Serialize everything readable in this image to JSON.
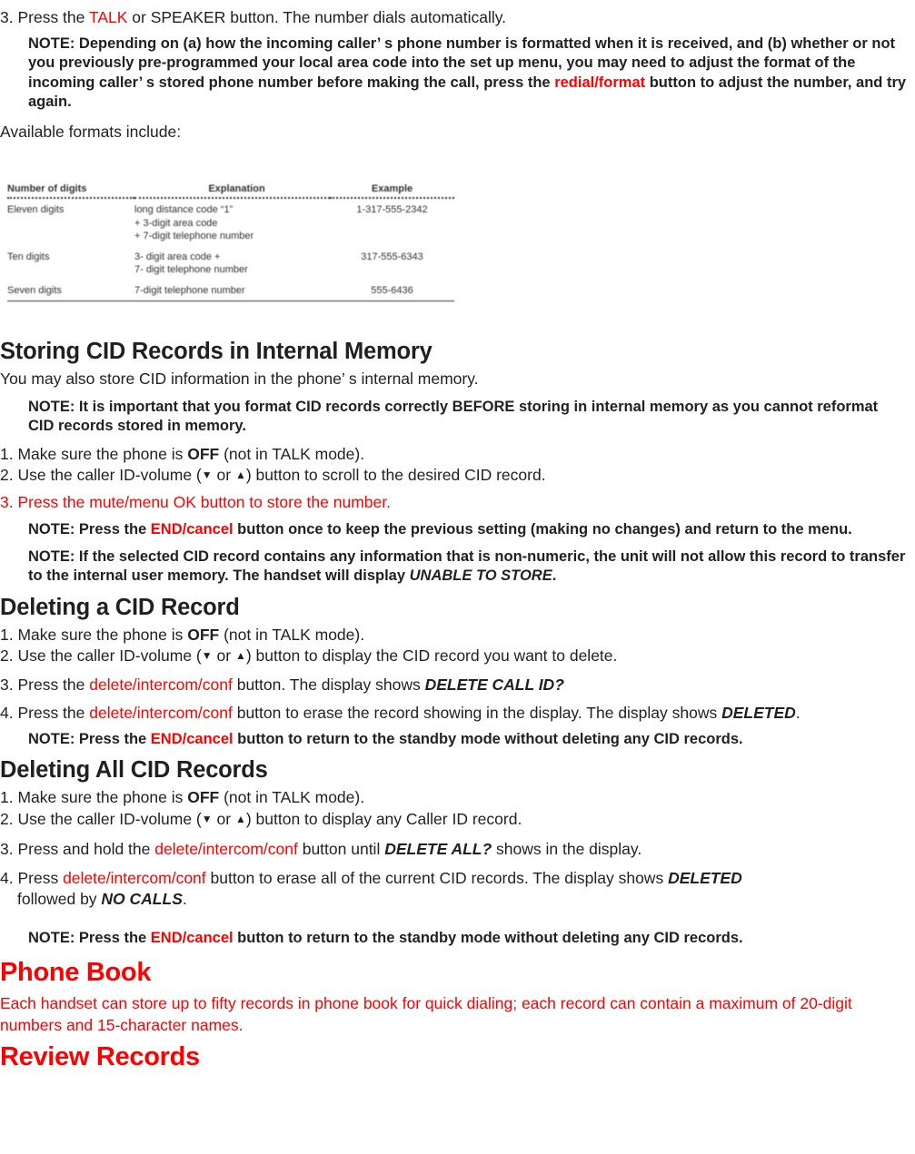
{
  "document": {
    "title": "Phone Book / CID Records Manual Page"
  },
  "colors": {
    "red": "#ff0000",
    "text": "#231f20"
  },
  "top_section": {
    "step3": {
      "num": "3. Press the ",
      "talk": "TALK",
      "rest": " or SPEAKER button. The number dials automatically."
    },
    "note1": {
      "lead": "NOTE: Depending on (a) how the incoming caller’ s phone number is formatted when it is received, and (b) whether or not you previously pre-programmed your local area code int",
      "lead2": "o the set up menu, you may need to adjust the format of the incoming caller’ s stored phone number before making the call, press the ",
      "redial": "redial/format",
      "tail": " button to adjust the number, and try again."
    },
    "available": "Available formats include:"
  },
  "formats_table": {
    "headers": [
      "Number of digits",
      "Explanation",
      "Example"
    ],
    "rows": [
      {
        "digits": "Eleven digits",
        "explanation": [
          "long distance code “1”",
          "+ 3-digit area code",
          "+ 7-digit telephone number"
        ],
        "example": "1-317-555-2342"
      },
      {
        "digits": "Ten digits",
        "explanation": [
          "3- digit area code +",
          "7- digit telephone number"
        ],
        "example": "317-555-6343"
      },
      {
        "digits": "Seven digits",
        "explanation": [
          "7-digit telephone number"
        ],
        "example": "555-6436"
      }
    ]
  },
  "storing": {
    "heading": "Storing CID Records in Internal Memory",
    "intro": "You may also store CID information in the phone’ s internal memory.",
    "note": "NOTE: It is important that you format CID records correctly BEFORE storing in internal memory as you cannot reformat CID records stored in memory.",
    "step1": {
      "pre": "1. Make sure the phone is ",
      "off": "OFF",
      "post": " (not in TALK mode)."
    },
    "step2": {
      "pre": "2. Use the caller ID-volume (",
      "down": "▼",
      "mid": " or ",
      "up": "▲",
      "post": ") button to scroll to the desired CID record."
    },
    "step3": "3. Press the mute/menu OK button to store the number.",
    "note2": {
      "pre": "NOTE: Press the ",
      "end": "END/cancel",
      "post": " button once to keep the previous setting (making no changes) and return to the menu."
    },
    "note3": {
      "pre": "NOTE: If the selected CID record contains any information that is non-numeric, the unit will not allow this record to transfer to the internal user memory. The handset will display ",
      "display": "UNABLE TO STORE",
      "post": "."
    }
  },
  "deleting_one": {
    "heading": "Deleting a CID Record",
    "step1": {
      "pre": "1. Make sure the phone is ",
      "off": "OFF",
      "post": " (not in TALK mode)."
    },
    "step2": {
      "pre": "2. Use the caller ID-volume (",
      "down": "▼",
      "mid": " or ",
      "up": "▲",
      "post": ") button to display the CID record you want to delete."
    },
    "step3": {
      "pre": "3. Press the ",
      "btn": "delete/intercom/conf",
      "mid": " button. The display shows ",
      "display": "DELETE CALL ID?"
    },
    "step4": {
      "pre": "4. Press the ",
      "btn": "delete/intercom/conf",
      "mid": " button to erase the record showing in the display. The display shows ",
      "display": "DELETED",
      "post": "."
    },
    "note": {
      "pre": "NOTE: Press the ",
      "end": "END/cancel",
      "post": " button to return to the standby mode without deleting any CID records."
    }
  },
  "deleting_all": {
    "heading": "Deleting All CID Records",
    "step1": {
      "pre": "1. Make sure the phone is ",
      "off": "OFF",
      "post": " (not in TALK mode)."
    },
    "step2": {
      "pre": "2. Use the caller ID-volume (",
      "down": "▼",
      "mid": " or ",
      "up": "▲",
      "post": ") button to display any Caller ID record."
    },
    "step3": {
      "pre": "3. Press and hold the ",
      "btn": "delete/intercom/conf",
      "mid": " button until ",
      "display": "DELETE ALL?",
      "post": " shows in the display."
    },
    "step4": {
      "pre": "4. Press ",
      "btn": "delete/intercom/conf",
      "mid": " button to erase all of the current CID records. The display shows ",
      "display": "DELETED",
      "post2": "followed by ",
      "display2": "NO CALLS",
      "post3": "."
    },
    "note": {
      "pre": "NOTE: Press the ",
      "end": "END/cancel",
      "post": " button to return to the standby mode without deleting any CID records."
    }
  },
  "phone_book": {
    "heading": "Phone Book",
    "intro": "Each handset can store up to fifty records in phone book for quick dialing; each record can contain a maximum of 20-digit numbers and 15-character names.",
    "sub_heading": "Review Records"
  }
}
